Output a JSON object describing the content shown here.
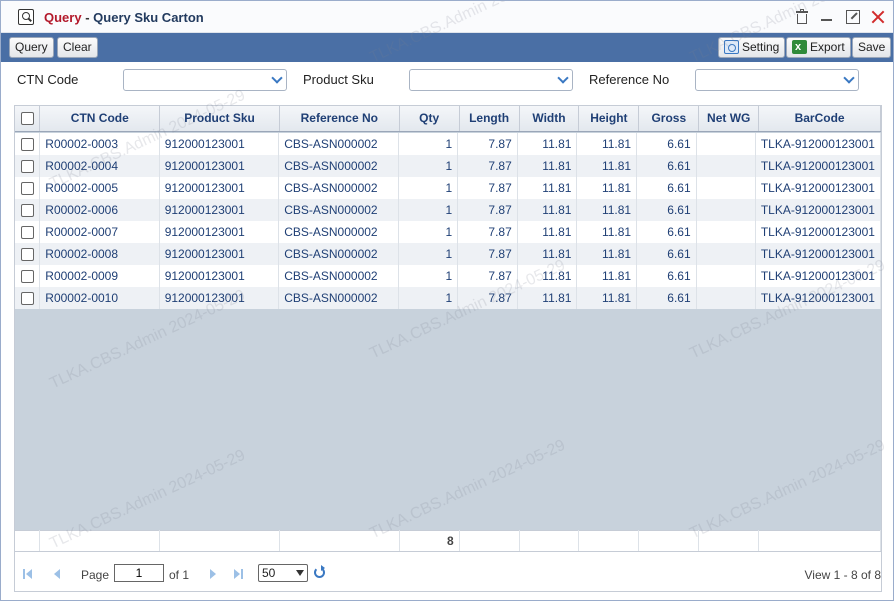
{
  "window": {
    "module": "Query",
    "separator": "-",
    "title": "Query Sku Carton"
  },
  "toolbar": {
    "query_label": "Query",
    "clear_label": "Clear",
    "setting_label": "Setting",
    "export_label": "Export",
    "save_label": "Save"
  },
  "filters": {
    "ctn_code_label": "CTN Code",
    "product_sku_label": "Product Sku",
    "reference_no_label": "Reference No",
    "ctn_code_value": "",
    "product_sku_value": "",
    "reference_no_value": ""
  },
  "grid": {
    "columns": [
      "CTN Code",
      "Product Sku",
      "Reference No",
      "Qty",
      "Length",
      "Width",
      "Height",
      "Gross",
      "Net WG",
      "BarCode"
    ],
    "rows": [
      [
        "R00002-0003",
        "912000123001",
        "CBS-ASN000002",
        "1",
        "7.87",
        "11.81",
        "11.81",
        "6.61",
        "",
        "TLKA-912000123001"
      ],
      [
        "R00002-0004",
        "912000123001",
        "CBS-ASN000002",
        "1",
        "7.87",
        "11.81",
        "11.81",
        "6.61",
        "",
        "TLKA-912000123001"
      ],
      [
        "R00002-0005",
        "912000123001",
        "CBS-ASN000002",
        "1",
        "7.87",
        "11.81",
        "11.81",
        "6.61",
        "",
        "TLKA-912000123001"
      ],
      [
        "R00002-0006",
        "912000123001",
        "CBS-ASN000002",
        "1",
        "7.87",
        "11.81",
        "11.81",
        "6.61",
        "",
        "TLKA-912000123001"
      ],
      [
        "R00002-0007",
        "912000123001",
        "CBS-ASN000002",
        "1",
        "7.87",
        "11.81",
        "11.81",
        "6.61",
        "",
        "TLKA-912000123001"
      ],
      [
        "R00002-0008",
        "912000123001",
        "CBS-ASN000002",
        "1",
        "7.87",
        "11.81",
        "11.81",
        "6.61",
        "",
        "TLKA-912000123001"
      ],
      [
        "R00002-0009",
        "912000123001",
        "CBS-ASN000002",
        "1",
        "7.87",
        "11.81",
        "11.81",
        "6.61",
        "",
        "TLKA-912000123001"
      ],
      [
        "R00002-0010",
        "912000123001",
        "CBS-ASN000002",
        "1",
        "7.87",
        "11.81",
        "11.81",
        "6.61",
        "",
        "TLKA-912000123001"
      ]
    ],
    "footer_qty_total": "8"
  },
  "pager": {
    "page_label": "Page",
    "page_value": "1",
    "of_label": "of 1",
    "page_size": "50",
    "view_text": "View 1 - 8 of 8"
  },
  "watermark": "TLKA.CBS.Admin 2024-05-29",
  "colors": {
    "toolbar_bg": "#4a6fa5",
    "header_text": "#1f3f75",
    "module_title": "#b3192b",
    "close_icon": "#d22b2b"
  }
}
